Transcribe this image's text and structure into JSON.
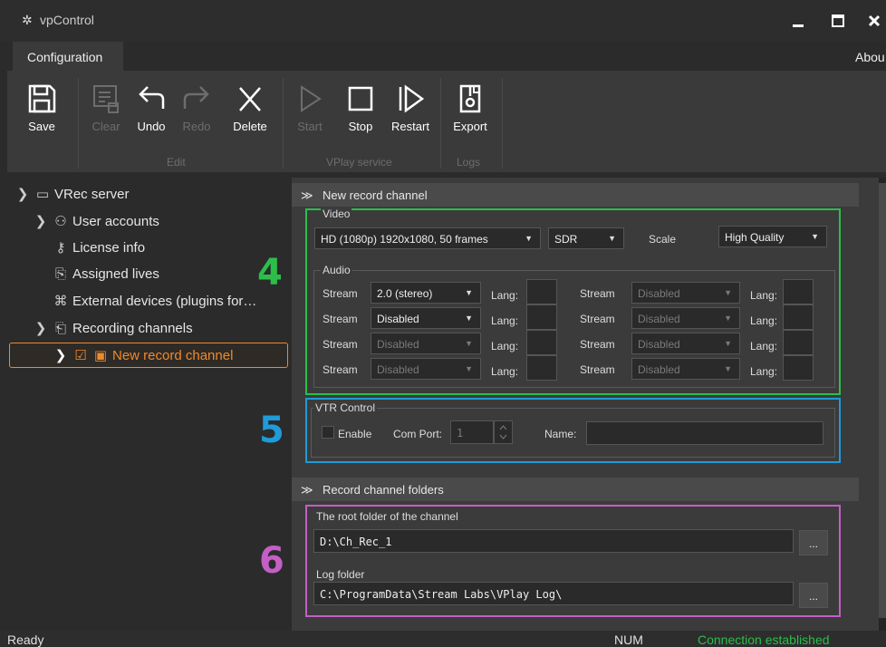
{
  "window": {
    "title": "vpControl"
  },
  "tabs": {
    "configuration": "Configuration",
    "about": "Abou"
  },
  "ribbon": {
    "save": "Save",
    "clear": "Clear",
    "undo": "Undo",
    "redo": "Redo",
    "delete": "Delete",
    "start": "Start",
    "stop": "Stop",
    "restart": "Restart",
    "export": "Export",
    "group_edit": "Edit",
    "group_vplay": "VPlay service",
    "group_logs": "Logs"
  },
  "tree": {
    "root": "VRec server",
    "user_accounts": "User accounts",
    "license_info": "License info",
    "assigned_lives": "Assigned lives",
    "external_devices": "External devices (plugins for…",
    "recording_channels": "Recording channels",
    "new_record_channel": "New record channel"
  },
  "markers": {
    "four": "4",
    "five": "5",
    "six": "6"
  },
  "colors": {
    "green": "#2bbf4a",
    "blue": "#1e9bd8",
    "purple": "#c35fc5",
    "orange": "#f0892b"
  },
  "section1": {
    "title": "New record channel",
    "video_label": "Video",
    "video_format": "HD (1080p) 1920x1080, 50 frames",
    "dynamic_range": "SDR",
    "scale_label": "Scale",
    "scale_value": "High Quality",
    "audio_label": "Audio",
    "stream_label": "Stream",
    "lang_label": "Lang:",
    "audio_left": [
      "2.0 (stereo)",
      "Disabled",
      "Disabled",
      "Disabled"
    ],
    "audio_right": [
      "Disabled",
      "Disabled",
      "Disabled",
      "Disabled"
    ],
    "vtr_label": "VTR Control",
    "enable_label": "Enable",
    "com_port_label": "Com Port:",
    "com_port_value": "1",
    "name_label": "Name:"
  },
  "section2": {
    "title": "Record channel folders",
    "root_folder_label": "The root folder of the channel",
    "root_folder_value": "D:\\Ch_Rec_1",
    "log_folder_label": "Log folder",
    "log_folder_value": "C:\\ProgramData\\Stream Labs\\VPlay Log\\",
    "browse": "..."
  },
  "status": {
    "ready": "Ready",
    "num": "NUM",
    "connection": "Connection established"
  }
}
